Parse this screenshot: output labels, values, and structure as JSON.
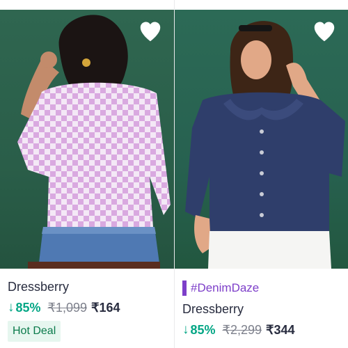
{
  "products": [
    {
      "brand": "Dressberry",
      "discount": "85%",
      "mrp": "₹1,099",
      "price": "₹164",
      "badge": "Hot Deal",
      "image_icon": "woman-back-checkered-pink-top-photo",
      "wishlist_icon": "heart-outline-icon"
    },
    {
      "tag": "#DenimDaze",
      "brand": "Dressberry",
      "discount": "85%",
      "mrp": "₹2,299",
      "price": "₹344",
      "image_icon": "woman-denim-ruffle-collar-top-photo",
      "wishlist_icon": "heart-outline-icon"
    }
  ],
  "glyphs": {
    "down_arrow": "↓"
  },
  "colors": {
    "discount_green": "#03a685",
    "badge_bg": "#e6f6ef",
    "tag_purple": "#7d3fc9",
    "image_bg": "#2a5e49"
  }
}
